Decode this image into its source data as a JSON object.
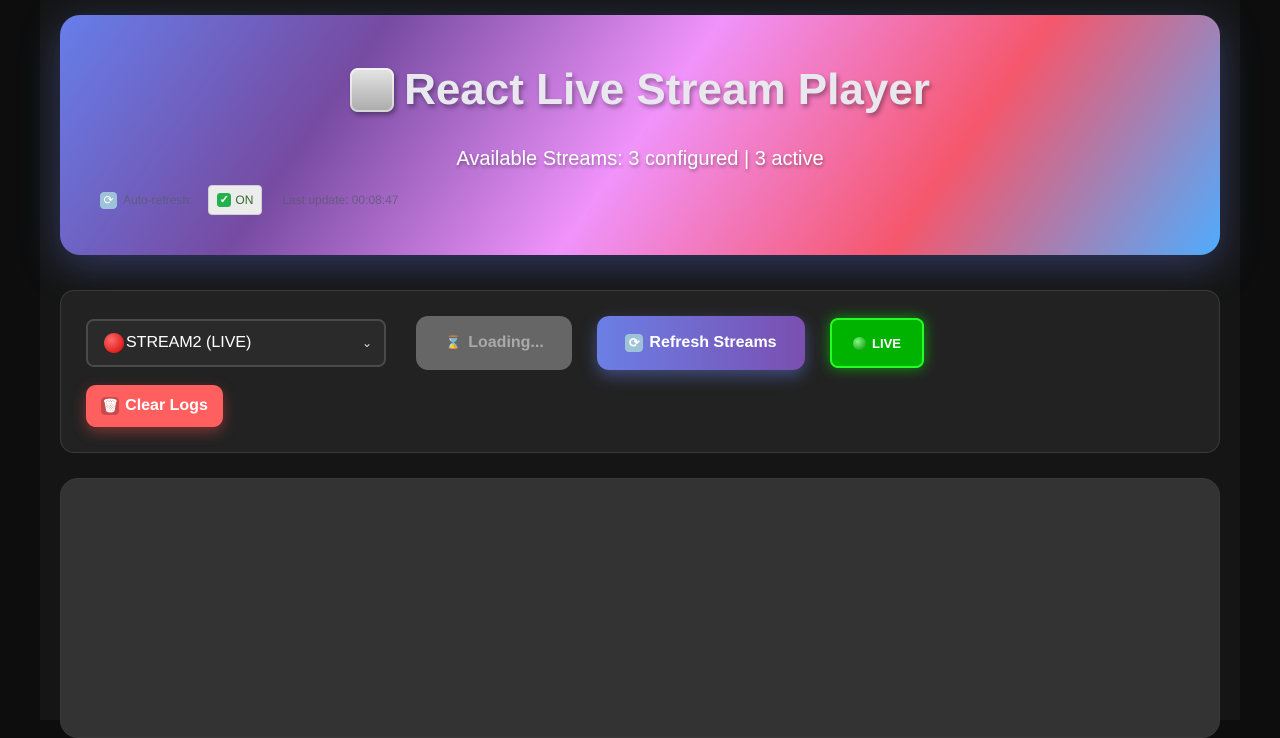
{
  "header": {
    "title": "React Live Stream Player",
    "title_icon": "stop-icon",
    "subtitle": "Available Streams: 3 configured | 3 active",
    "auto_refresh_label": "Auto-refresh:",
    "auto_refresh_icon": "refresh-icon",
    "toggle_label": "ON",
    "last_update": "Last update: 00:08:47"
  },
  "controls": {
    "stream_select": {
      "selected": "STREAM2 (LIVE)",
      "status_icon": "red-circle-icon"
    },
    "loading_button": "Loading...",
    "refresh_button": "Refresh Streams",
    "live_button": "LIVE",
    "clear_logs_button": "Clear Logs"
  },
  "colors": {
    "header_gradient": [
      "#667eea",
      "#764ba2",
      "#f093fb",
      "#f5576c",
      "#4facfe"
    ],
    "live_green": "#00b300",
    "clear_red": "#ff5f5f",
    "refresh_start": "#6b7fe6",
    "refresh_end": "#7a4fb0"
  }
}
